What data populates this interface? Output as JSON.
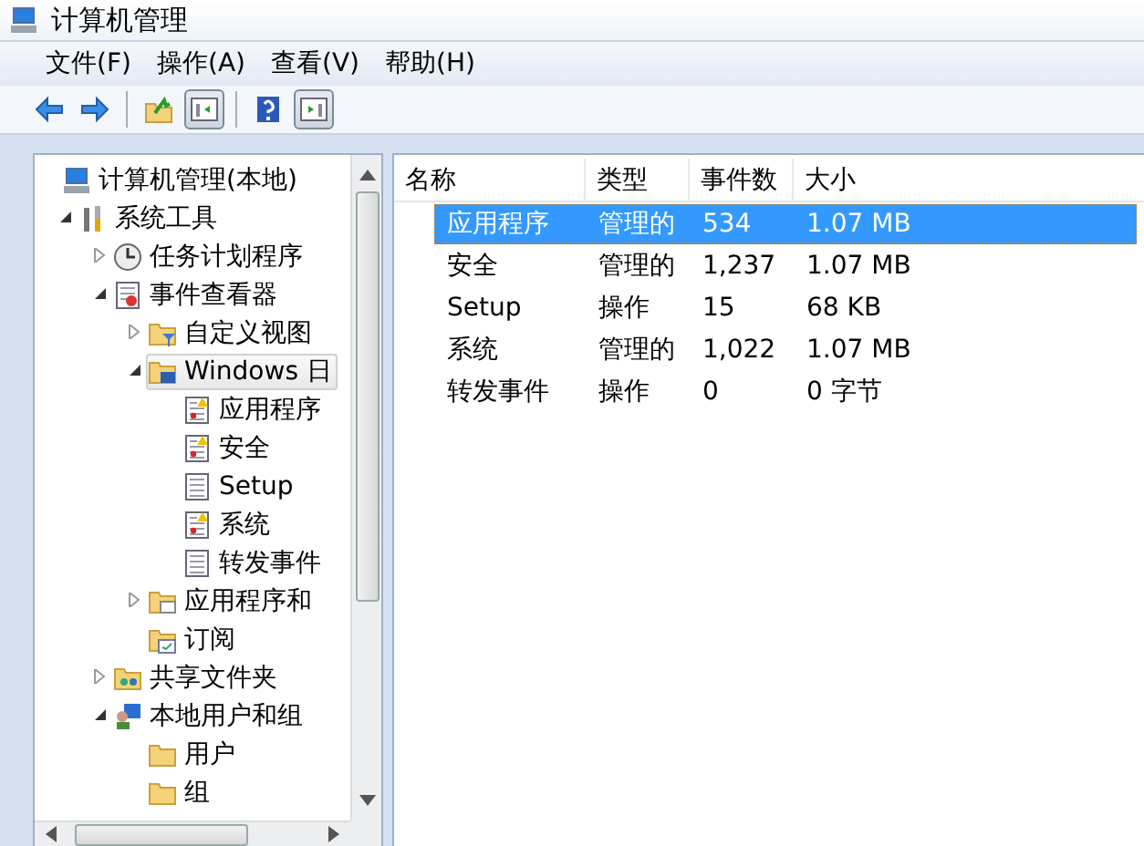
{
  "window": {
    "title": "计算机管理"
  },
  "menu": [
    "文件(F)",
    "操作(A)",
    "查看(V)",
    "帮助(H)"
  ],
  "toolbar": [
    {
      "kind": "back",
      "pressed": false
    },
    {
      "kind": "forward",
      "pressed": false
    },
    {
      "kind": "sep"
    },
    {
      "kind": "up",
      "pressed": false
    },
    {
      "kind": "tree-pane",
      "pressed": true
    },
    {
      "kind": "sep"
    },
    {
      "kind": "help",
      "pressed": false
    },
    {
      "kind": "action-pane",
      "pressed": true
    }
  ],
  "tree": [
    {
      "label": "计算机管理(本地)",
      "kind": "computer",
      "selected": false,
      "children": [
        {
          "label": "系统工具",
          "kind": "tools",
          "expanded": true,
          "selected": false,
          "children": [
            {
              "label": "任务计划程序",
              "kind": "clock",
              "expanded": false,
              "selected": false
            },
            {
              "label": "事件查看器",
              "kind": "viewer",
              "expanded": true,
              "selected": false,
              "children": [
                {
                  "label": "自定义视图",
                  "kind": "filter-folder",
                  "expanded": false,
                  "selected": false
                },
                {
                  "label": "Windows 日",
                  "kind": "log-folder",
                  "expanded": true,
                  "selected": true,
                  "children": [
                    {
                      "label": "应用程序",
                      "kind": "log-warning",
                      "selected": false
                    },
                    {
                      "label": "安全",
                      "kind": "log-warning",
                      "selected": false
                    },
                    {
                      "label": "Setup",
                      "kind": "log",
                      "selected": false
                    },
                    {
                      "label": "系统",
                      "kind": "log-warning",
                      "selected": false
                    },
                    {
                      "label": "转发事件",
                      "kind": "log",
                      "selected": false
                    }
                  ]
                },
                {
                  "label": "应用程序和",
                  "kind": "app-folder",
                  "expanded": false,
                  "selected": false
                },
                {
                  "label": "订阅",
                  "kind": "sub-folder",
                  "selected": false
                }
              ]
            },
            {
              "label": "共享文件夹",
              "kind": "shared-folder",
              "expanded": false,
              "selected": false
            },
            {
              "label": "本地用户和组",
              "kind": "users",
              "expanded": true,
              "selected": false,
              "children": [
                {
                  "label": "用户",
                  "kind": "folder",
                  "selected": false
                },
                {
                  "label": "组",
                  "kind": "folder",
                  "selected": false
                }
              ]
            }
          ]
        }
      ]
    }
  ],
  "list": {
    "columns": [
      "名称",
      "类型",
      "事件数",
      "大小"
    ],
    "rows": [
      {
        "cells": [
          "应用程序",
          "管理的",
          "534",
          "1.07 MB"
        ],
        "selected": true
      },
      {
        "cells": [
          "安全",
          "管理的",
          "1,237",
          "1.07 MB"
        ],
        "selected": false
      },
      {
        "cells": [
          "Setup",
          "操作",
          "15",
          "68 KB"
        ],
        "selected": false
      },
      {
        "cells": [
          "系统",
          "管理的",
          "1,022",
          "1.07 MB"
        ],
        "selected": false
      },
      {
        "cells": [
          "转发事件",
          "操作",
          "0",
          "0 字节"
        ],
        "selected": false
      }
    ]
  }
}
